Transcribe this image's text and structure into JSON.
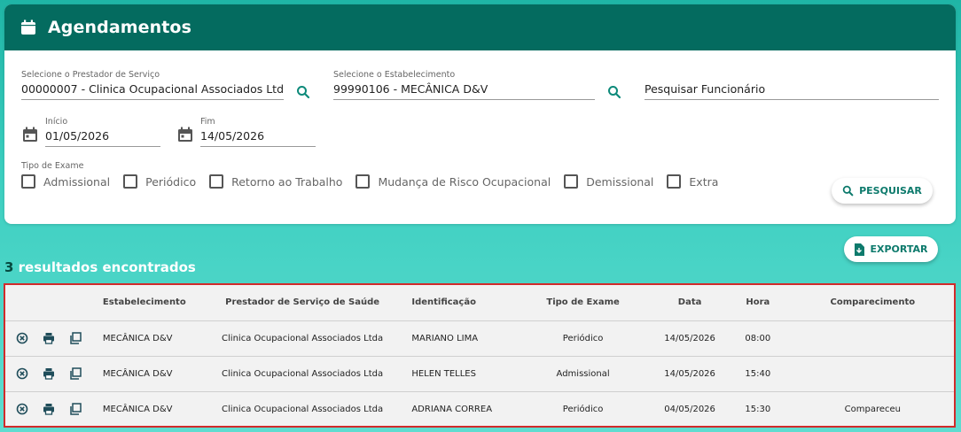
{
  "header": {
    "title": "Agendamentos",
    "icon": "calendar-icon"
  },
  "filters": {
    "provider": {
      "label": "Selecione o Prestador de Serviço",
      "value": "00000007 - Clinica Ocupacional Associados Ltda"
    },
    "establishment": {
      "label": "Selecione o Estabelecimento",
      "value": "99990106 - MECÂNICA D&V"
    },
    "employee": {
      "placeholder": "Pesquisar Funcionário"
    },
    "start": {
      "label": "Início",
      "value": "01/05/2026"
    },
    "end": {
      "label": "Fim",
      "value": "14/05/2026"
    },
    "exam_types_label": "Tipo de Exame",
    "exam_types": [
      "Admissional",
      "Periódico",
      "Retorno ao Trabalho",
      "Mudança de Risco Ocupacional",
      "Demissional",
      "Extra"
    ],
    "search_button": "PESQUISAR"
  },
  "export_button": "EXPORTAR",
  "results": {
    "count": "3",
    "text": " resultados encontrados"
  },
  "table": {
    "columns": [
      "Estabelecimento",
      "Prestador de Serviço de Saúde",
      "Identificação",
      "Tipo de Exame",
      "Data",
      "Hora",
      "Comparecimento"
    ],
    "rows": [
      {
        "estabelecimento": "MECÂNICA D&V",
        "prestador": "Clinica Ocupacional Associados Ltda",
        "identificacao": "MARIANO LIMA",
        "tipo": "Periódico",
        "data": "14/05/2026",
        "hora": "08:00",
        "comparecimento": ""
      },
      {
        "estabelecimento": "MECÂNICA D&V",
        "prestador": "Clinica Ocupacional Associados Ltda",
        "identificacao": "HELEN TELLES",
        "tipo": "Admissional",
        "data": "14/05/2026",
        "hora": "15:40",
        "comparecimento": ""
      },
      {
        "estabelecimento": "MECÂNICA D&V",
        "prestador": "Clinica Ocupacional Associados Ltda",
        "identificacao": "ADRIANA CORREA",
        "tipo": "Periódico",
        "data": "04/05/2026",
        "hora": "15:30",
        "comparecimento": "Compareceu"
      }
    ]
  },
  "colors": {
    "header": "#046b5f",
    "accent": "#0d7a6c",
    "highlight_border": "#d12b2b"
  }
}
